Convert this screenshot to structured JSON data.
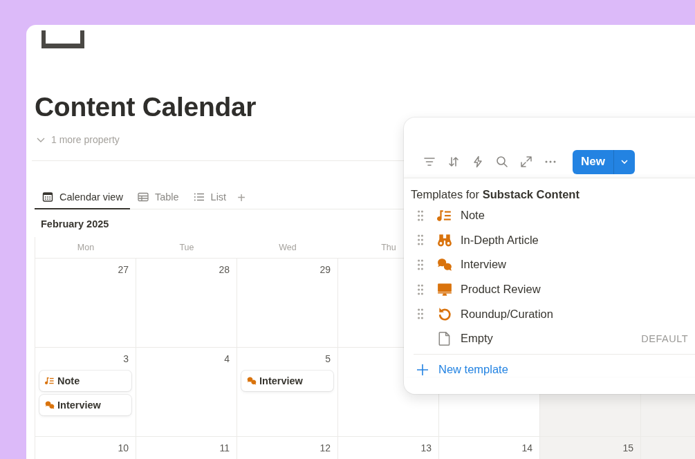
{
  "page": {
    "title": "Content Calendar",
    "more_properties": "1 more property"
  },
  "views": [
    {
      "label": "Calendar view",
      "kind": "calendar",
      "selected": true
    },
    {
      "label": "Table",
      "kind": "table",
      "selected": false
    },
    {
      "label": "List",
      "kind": "list",
      "selected": false
    }
  ],
  "add_view": "+",
  "calendar": {
    "month": "February 2025",
    "weekdays": [
      "Mon",
      "Tue",
      "Wed",
      "Thu"
    ],
    "weeks": [
      {
        "days": [
          {
            "date": "27",
            "weekend": false
          },
          {
            "date": "28",
            "weekend": false
          },
          {
            "date": "29",
            "weekend": false
          },
          {
            "weekend": false
          }
        ]
      },
      {
        "days": [
          {
            "date": "3",
            "weekend": false,
            "events": [
              {
                "title": "Note",
                "kind": "note"
              },
              {
                "title": "Interview",
                "kind": "chat"
              }
            ]
          },
          {
            "date": "4",
            "weekend": false
          },
          {
            "date": "5",
            "weekend": false,
            "events": [
              {
                "title": "Interview",
                "kind": "chat"
              }
            ]
          },
          {
            "weekend": false
          },
          {
            "weekend": false
          },
          {
            "weekend": true
          },
          {
            "weekend": true
          }
        ]
      },
      {
        "days": [
          {
            "date": "10",
            "weekend": false
          },
          {
            "date": "11",
            "weekend": false
          },
          {
            "date": "12",
            "weekend": false
          },
          {
            "date": "13",
            "weekend": false
          },
          {
            "date": "14",
            "weekend": false
          },
          {
            "date": "15",
            "weekend": true
          },
          {
            "weekend": true
          }
        ]
      }
    ]
  },
  "toolbar": {
    "new_button": "New"
  },
  "templates": {
    "heading": "Templates for **Substack Content**",
    "items": [
      {
        "label": "Note",
        "kind": "note",
        "draggable": true
      },
      {
        "label": "In-Depth Article",
        "kind": "binoculars",
        "draggable": true
      },
      {
        "label": "Interview",
        "kind": "chat",
        "draggable": true
      },
      {
        "label": "Product Review",
        "kind": "monitor",
        "draggable": true
      },
      {
        "label": "Roundup/Curation",
        "kind": "rotate",
        "draggable": true
      },
      {
        "label": "Empty",
        "kind": "document",
        "draggable": false,
        "badge": "DEFAULT"
      }
    ],
    "new_template": "New template"
  }
}
